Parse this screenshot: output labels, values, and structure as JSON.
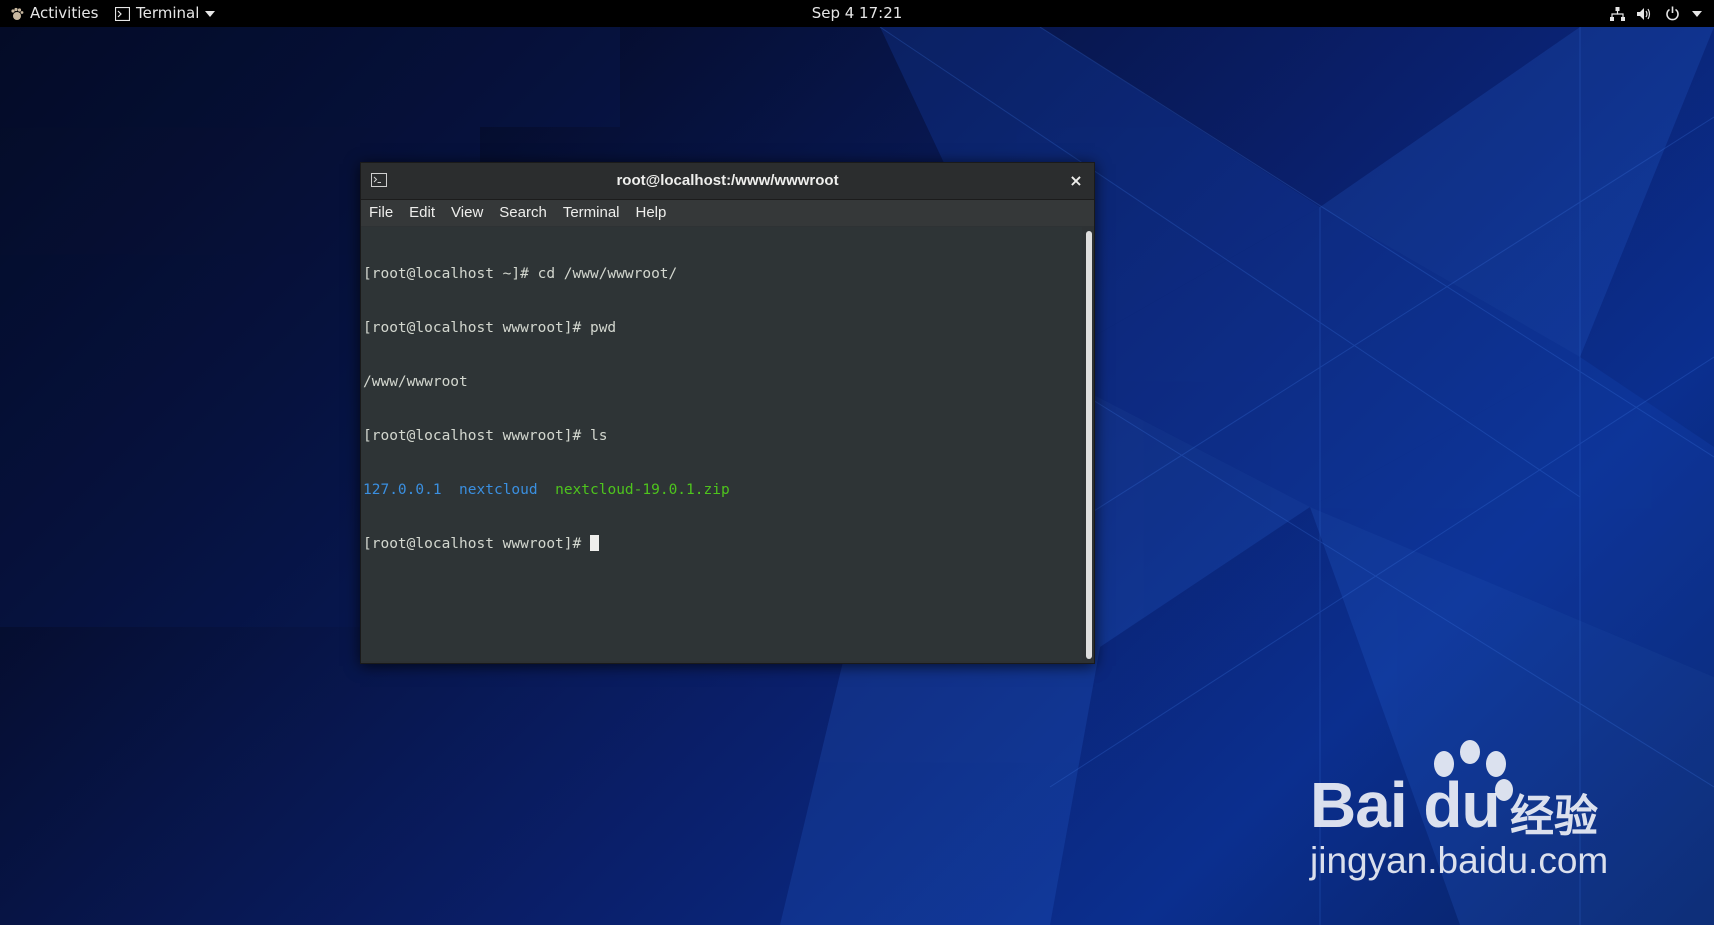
{
  "topbar": {
    "activities_label": "Activities",
    "app_menu_label": "Terminal",
    "clock": "Sep 4  17:21",
    "tray_icons": [
      "network-icon",
      "volume-icon",
      "power-icon",
      "chevron-down-icon"
    ]
  },
  "window": {
    "title": "root@localhost:/www/wwwroot",
    "close_glyph": "×",
    "menus": [
      "File",
      "Edit",
      "View",
      "Search",
      "Terminal",
      "Help"
    ]
  },
  "terminal": {
    "lines": [
      "[root@localhost ~]# cd /www/wwwroot/",
      "[root@localhost wwwroot]# pwd",
      "/www/wwwroot",
      "[root@localhost wwwroot]# ls"
    ],
    "ls_output": {
      "dir1": "127.0.0.1",
      "dir2": "nextcloud",
      "file1": "nextcloud-19.0.1.zip"
    },
    "prompt": "[root@localhost wwwroot]# ",
    "colors": {
      "directory": "#3a8fe0",
      "archive": "#4ec41d",
      "text": "#d3d7cf",
      "background": "#2e3436"
    }
  },
  "watermark": {
    "brand": "Bai du",
    "brand_cn": "经验",
    "site": "jingyan.baidu.com"
  }
}
